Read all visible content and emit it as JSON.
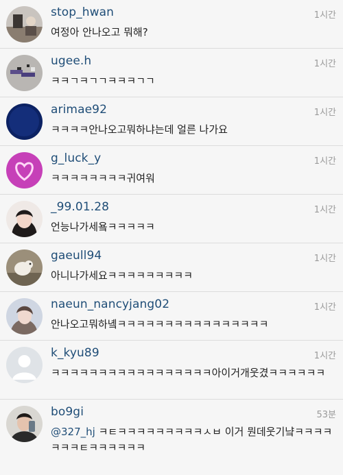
{
  "comments": [
    {
      "username": "stop_hwan",
      "time": "1시간",
      "text": "여정아 안나오고 뭐해?",
      "avatar_icon": "profile-photo-room"
    },
    {
      "username": "ugee.h",
      "time": "1시간",
      "text": "ㅋㅋㄱㅋㄱㄱㅋㅋㅋㄱㄱ",
      "avatar_icon": "profile-photo-pixel-art"
    },
    {
      "username": "arimae92",
      "time": "1시간",
      "text": "ㅋㅋㅋㅋ안나오고뭐하냐는데 얼른 나가요",
      "avatar_icon": "profile-photo-blue"
    },
    {
      "username": "g_luck_y",
      "time": "1시간",
      "text": "ㅋㅋㅋㅋㅋㅋㅋㅋ귀여워",
      "avatar_icon": "profile-photo-neon-heart"
    },
    {
      "username": "_99.01.28",
      "time": "1시간",
      "text": "언능나가세욬ㅋㅋㅋㅋㅋ",
      "avatar_icon": "profile-photo-girl"
    },
    {
      "username": "gaeull94",
      "time": "1시간",
      "text": "아니나가세요ㅋㅋㅋㅋㅋㅋㅋㅋㅋ",
      "avatar_icon": "profile-photo-dog"
    },
    {
      "username": "naeun_nancyjang02",
      "time": "1시간",
      "text": "안나오고뭐하녴ㅋㅋㅋㅋㅋㅋㅋㅋㅋㅋㅋㅋㅋㅋㅋㅋ",
      "avatar_icon": "profile-photo-girl-2"
    },
    {
      "username": "k_kyu89",
      "time": "1시간",
      "text": "ㅋㅋㅋㅋㅋㅋㅋㅋㅋㅋㅋㅋㅋㅋㅋㅋㅋ아이거개웃겼ㅋㅋㅋㅋㅋㅋ",
      "avatar_icon": "default-avatar-icon"
    },
    {
      "username": "bo9gi",
      "time": "53분",
      "mention": "@327_hj",
      "text": " ㅋㅌㅋㅋㅋㅋㅋㅋㅋㅋㅋㅅㅂ 이거 뭔데웃기냨ㅋㅋㅋㅋㅋㅋㅋㅌㅋㅋㅋㅋㅋㅋ",
      "avatar_icon": "profile-photo-boy"
    }
  ]
}
